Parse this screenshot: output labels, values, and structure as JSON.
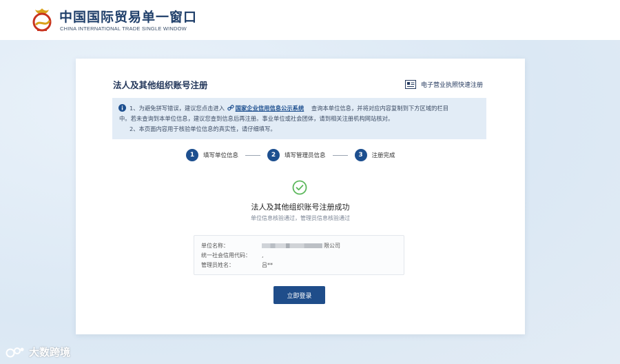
{
  "header": {
    "logo_cn": "中国国际贸易单一窗口",
    "logo_en": "CHINA INTERNATIONAL TRADE SINGLE WINDOW",
    "logo_icon": "single-window-logo-icon"
  },
  "card": {
    "title": "法人及其他组织账号注册",
    "quick_register_label": "电子营业执照快速注册",
    "quick_register_icon": "license-card-icon"
  },
  "notice": {
    "line1_prefix": "1、为避免拼写错误，建议您点击进入",
    "link_text": "国家企业信用信息公示系统",
    "line1_suffix": "查询本单位信息，并将对应内容复制到下方区域的栏目",
    "line2": "中。若未查询到本单位信息，建议您查到信息后再注册。事业单位或社会团体，请到相关注册机构网站核对。",
    "line3": "2、本页面内容用于核验单位信息的真实性，请仔细填写。"
  },
  "steps": [
    {
      "num": "1",
      "label": "填写单位信息"
    },
    {
      "num": "2",
      "label": "填写管理员信息"
    },
    {
      "num": "3",
      "label": "注册完成"
    }
  ],
  "result": {
    "title": "法人及其他组织账号注册成功",
    "subtitle": "单位信息核验通过，管理员信息核验通过",
    "icon": "check-circle-icon"
  },
  "info": {
    "company_label": "单位名称：",
    "company_value_visible": "限公司",
    "credit_code_label": "统一社会信用代码：",
    "credit_code_value": ",",
    "admin_label": "管理员姓名：",
    "admin_value": "吕**"
  },
  "login_button": "立即登录",
  "watermark": "大数跨境",
  "colors": {
    "primary": "#1f4d8a",
    "success": "#5bb75b",
    "notice_bg": "#e2ecf6"
  }
}
